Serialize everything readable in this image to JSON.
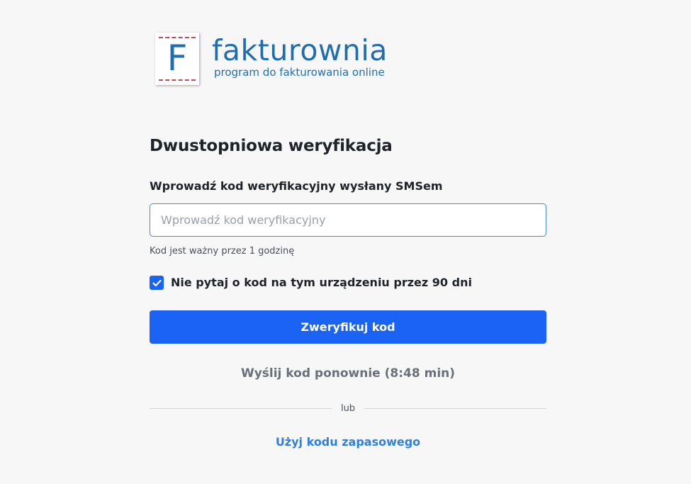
{
  "logo": {
    "letter": "F",
    "name": "fakturownia",
    "tagline": "program do fakturowania online"
  },
  "page": {
    "title": "Dwustopniowa weryfikacja"
  },
  "form": {
    "code_label": "Wprowadź kod weryfikacyjny wysłany SMSem",
    "code_placeholder": "Wprowadź kod weryfikacyjny",
    "code_value": "",
    "validity_hint": "Kod jest ważny przez 1 godzinę",
    "remember_label": "Nie pytaj o kod na tym urządzeniu przez 90 dni",
    "remember_checked": true,
    "submit_label": "Zweryfikuj kod",
    "resend_label": "Wyślij kod ponownie (8:48 min)",
    "divider_text": "lub",
    "backup_link": "Użyj kodu zapasowego"
  },
  "icons": {
    "checkbox": "check-icon"
  },
  "colors": {
    "brand_blue": "#1f6fb0",
    "primary": "#1a63f5",
    "link": "#2f7fe0",
    "logo_dash": "#c44a56",
    "background": "#f7f7f8"
  }
}
